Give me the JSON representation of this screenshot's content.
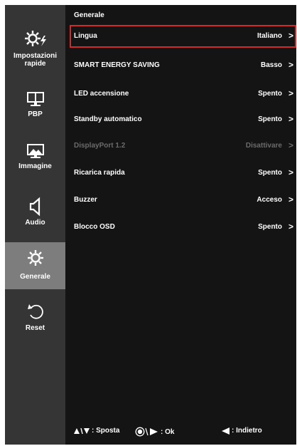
{
  "sidebar": {
    "items": [
      {
        "label": "Impostazioni rapide",
        "icon": "quick-settings-icon"
      },
      {
        "label": "PBP",
        "icon": "pbp-icon"
      },
      {
        "label": "Immagine",
        "icon": "picture-icon"
      },
      {
        "label": "Audio",
        "icon": "speaker-icon"
      },
      {
        "label": "Generale",
        "icon": "gear-icon"
      },
      {
        "label": "Reset",
        "icon": "reset-icon"
      }
    ],
    "selected": "Generale"
  },
  "main": {
    "title": "Generale",
    "rows": [
      {
        "label": "Lingua",
        "value": "Italiano",
        "selected": true,
        "disabled": false
      },
      {
        "label": "SMART ENERGY SAVING",
        "value": "Basso",
        "selected": false,
        "disabled": false
      },
      {
        "label": "LED accensione",
        "value": "Spento",
        "selected": false,
        "disabled": false
      },
      {
        "label": "Standby automatico",
        "value": "Spento",
        "selected": false,
        "disabled": false
      },
      {
        "label": "DisplayPort 1.2",
        "value": "Disattivare",
        "selected": false,
        "disabled": true
      },
      {
        "label": "Ricarica rapida",
        "value": "Spento",
        "selected": false,
        "disabled": false
      },
      {
        "label": "Buzzer",
        "value": "Acceso",
        "selected": false,
        "disabled": false
      },
      {
        "label": "Blocco OSD",
        "value": "Spento",
        "selected": false,
        "disabled": false
      }
    ],
    "chevron": ">"
  },
  "footer": {
    "move_label": ": Sposta",
    "ok_label": ": Ok",
    "back_label": ": Indietro",
    "move_icon": "up-down-arrows-icon",
    "ok_icon": "joystick-right-icon",
    "back_icon": "left-arrow-icon"
  },
  "colors": {
    "panel_bg": "#141414",
    "sidebar_bg": "#353535",
    "sidebar_selected_bg": "#7d7d7d",
    "highlight_border": "#d12a2a",
    "text": "#ffffff",
    "disabled_text": "#6b6b6b"
  }
}
